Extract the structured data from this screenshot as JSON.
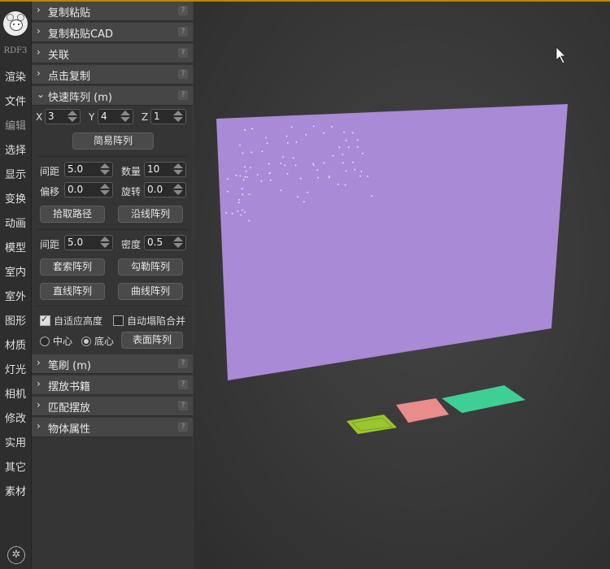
{
  "rail": {
    "version": "RDF3",
    "items": [
      "渲染",
      "文件",
      "编辑",
      "选择",
      "显示",
      "变换",
      "动画",
      "模型",
      "室内",
      "室外",
      "图形",
      "材质",
      "灯光",
      "相机",
      "修改",
      "实用",
      "其它",
      "素材"
    ],
    "active_index": 2
  },
  "sections_top": [
    {
      "title": "复制粘贴"
    },
    {
      "title": "复制粘贴CAD"
    },
    {
      "title": "关联"
    },
    {
      "title": "点击复制"
    }
  ],
  "quick_array": {
    "title": "快速阵列 (m)",
    "x_label": "X",
    "x_value": "3",
    "y_label": "Y",
    "y_value": "4",
    "z_label": "Z",
    "z_value": "1",
    "simple_button": "简易阵列",
    "spacing_label": "间距",
    "spacing_value": "5.0",
    "count_label": "数量",
    "count_value": "10",
    "offset_label": "偏移",
    "offset_value": "0.0",
    "rotate_label": "旋转",
    "rotate_value": "0.0",
    "pick_path_button": "拾取路径",
    "along_line_button": "沿线阵列",
    "spacing2_label": "间距",
    "spacing2_value": "5.0",
    "density_label": "密度",
    "density_value": "0.5",
    "lasso_button": "套索阵列",
    "outline_button": "勾勒阵列",
    "straight_button": "直线阵列",
    "curve_button": "曲线阵列",
    "adaptive_height_label": "自适应高度",
    "adaptive_height_checked": true,
    "auto_collapse_label": "自动塌陷合并",
    "auto_collapse_checked": false,
    "center_label": "中心",
    "bottom_center_label": "底心",
    "pivot_selected": "底心",
    "surface_button": "表面阵列"
  },
  "sections_bottom": [
    {
      "title": "笔刷 (m)"
    },
    {
      "title": "摆放书籍"
    },
    {
      "title": "匹配摆放"
    },
    {
      "title": "物体属性"
    }
  ],
  "help_glyph": "?",
  "viewport": {
    "bracket": "]",
    "plane_color": "#a98ad6",
    "tile_colors": [
      "#9bc62e",
      "#e88c8c",
      "#3fcf94"
    ]
  },
  "colors": {
    "accent_line": "#b8860b"
  }
}
